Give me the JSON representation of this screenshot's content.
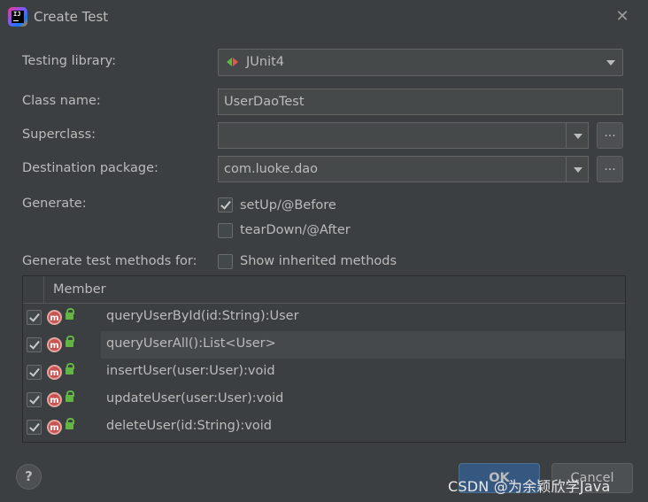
{
  "dialog": {
    "title": "Create Test",
    "close_icon": "close-icon",
    "app_icon_text": "IJ"
  },
  "form": {
    "testing_library": {
      "label": "Testing library:",
      "value": "JUnit4"
    },
    "class_name": {
      "label": "Class name:",
      "value": "UserDaoTest"
    },
    "superclass": {
      "label": "Superclass:",
      "value": "",
      "browse_label": "..."
    },
    "destination_package": {
      "label": "Destination package:",
      "value": "com.luoke.dao",
      "browse_label": "..."
    },
    "generate": {
      "label": "Generate:",
      "options": [
        {
          "label": "setUp/@Before",
          "checked": true
        },
        {
          "label": "tearDown/@After",
          "checked": false
        }
      ]
    },
    "methods_for": {
      "label": "Generate test methods for:",
      "inherited_label": "Show inherited methods",
      "inherited_checked": false
    }
  },
  "table": {
    "header": "Member",
    "rows": [
      {
        "text": "queryUserById(id:String):User",
        "checked": true
      },
      {
        "text": "queryUserAll():List<User>",
        "checked": true,
        "selected": true
      },
      {
        "text": "insertUser(user:User):void",
        "checked": true
      },
      {
        "text": "updateUser(user:User):void",
        "checked": true
      },
      {
        "text": "deleteUser(id:String):void",
        "checked": true
      }
    ]
  },
  "footer": {
    "help_label": "?",
    "ok_label": "OK",
    "cancel_label": "Cancel"
  },
  "watermark": "CSDN @为余颖欣学Java",
  "colors": {
    "background": "#3c3f41",
    "field": "#45494a",
    "primary_button": "#365880",
    "method_icon": "#c75450",
    "lock_icon": "#62b543"
  }
}
